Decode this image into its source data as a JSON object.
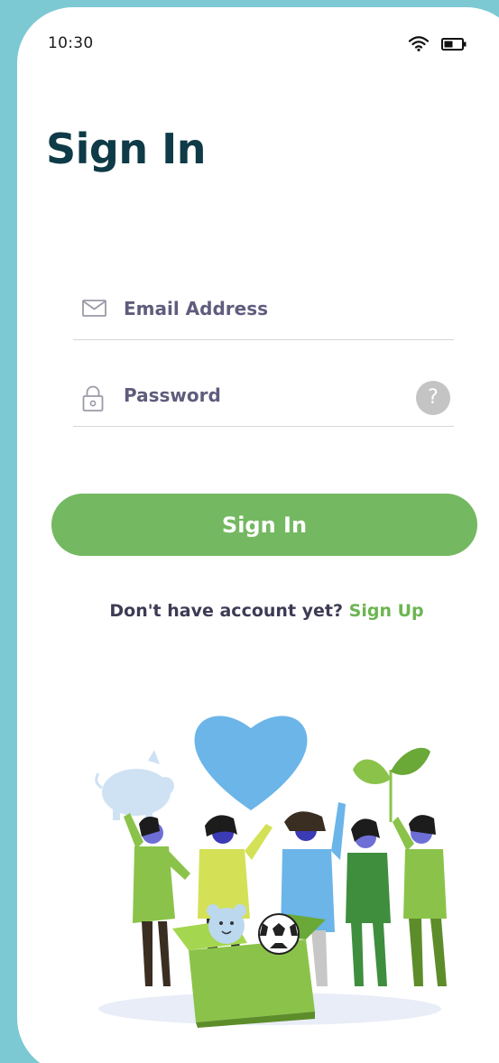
{
  "status_bar": {
    "time": "10:30",
    "icons": [
      "wifi-icon",
      "battery-icon"
    ]
  },
  "header": {
    "title": "Sign In"
  },
  "form": {
    "email": {
      "placeholder": "Email Address",
      "icon": "mail-icon"
    },
    "password": {
      "placeholder": "Password",
      "icon": "lock-icon",
      "help_icon": "?"
    },
    "submit_label": "Sign In"
  },
  "footer": {
    "prompt": "Don't have account yet? ",
    "link": "Sign Up"
  },
  "colors": {
    "frame": "#7cc9d3",
    "title": "#0f3a47",
    "label": "#5f5c7d",
    "primary_button": "#74b861",
    "link": "#6cb552",
    "help_button": "#c4c4c4"
  },
  "illustration": {
    "subject": "group of volunteers holding a heart, piggy bank and plant over a donation box with toys"
  }
}
